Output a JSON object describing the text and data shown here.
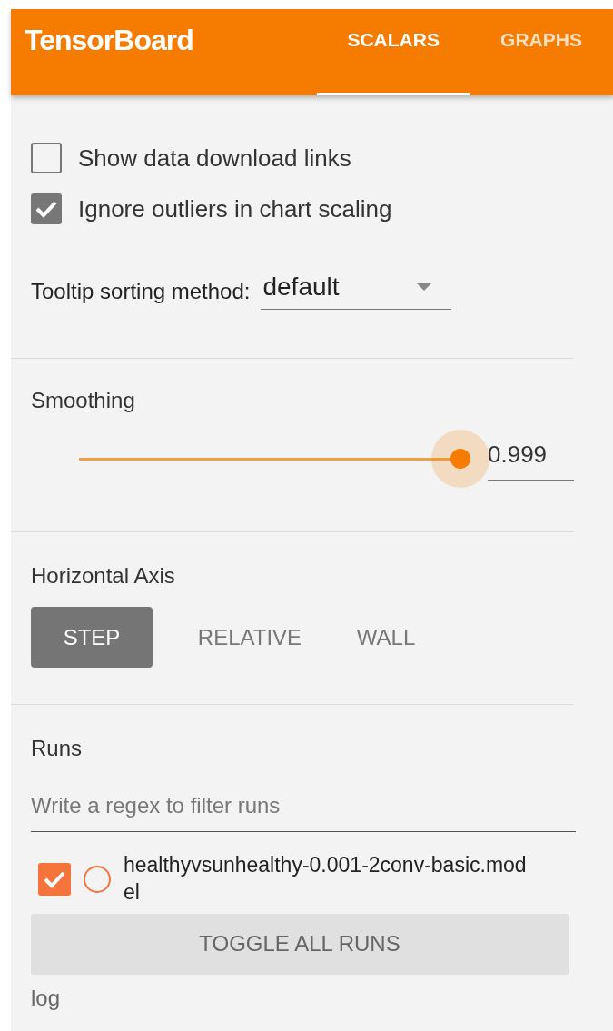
{
  "header": {
    "title": "TensorBoard",
    "tabs": [
      {
        "label": "SCALARS",
        "selected": true
      },
      {
        "label": "GRAPHS",
        "selected": false
      }
    ]
  },
  "options": [
    {
      "label": "Show data download links",
      "checked": false
    },
    {
      "label": "Ignore outliers in chart scaling",
      "checked": true
    }
  ],
  "tooltip_sorting": {
    "label": "Tooltip sorting method:",
    "value": "default"
  },
  "smoothing": {
    "label": "Smoothing",
    "level": 0.999,
    "value": "0.999"
  },
  "horizontal_axis": {
    "label": "Horizontal Axis",
    "options": [
      {
        "label": "STEP",
        "selected": true
      },
      {
        "label": "RELATIVE",
        "selected": false
      },
      {
        "label": "WALL",
        "selected": false
      }
    ]
  },
  "runs": {
    "label": "Runs",
    "filter": {
      "placeholder": "Write a regex to filter runs"
    },
    "items": [
      {
        "name": "healthyvsunhealthy-0.001-2conv-basic.model",
        "checked": true,
        "radio_selected": false,
        "color": "#f4743b"
      }
    ],
    "toggle_button": "TOGGLE ALL RUNS",
    "footer": "log"
  }
}
